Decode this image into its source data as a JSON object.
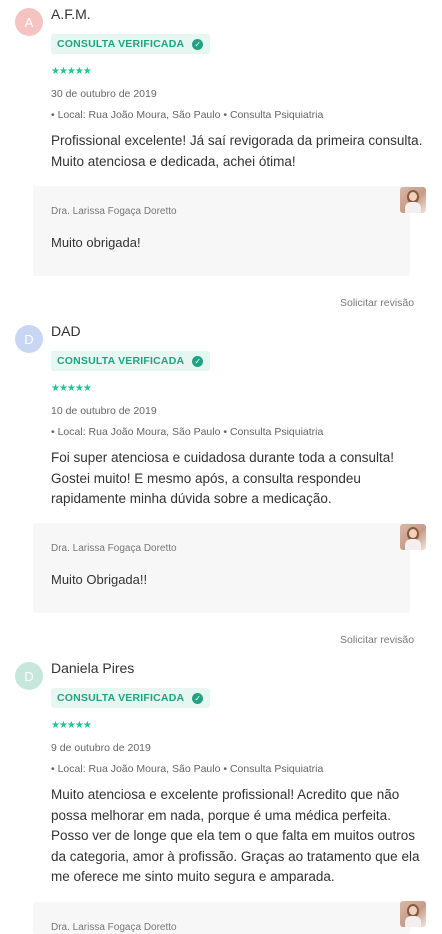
{
  "reviews": [
    {
      "initial": "A",
      "name": "A.F.M.",
      "badge": "CONSULTA VERIFICADA",
      "stars": "★★★★★",
      "date": "30 de outubro de 2019",
      "location": "• Local: Rua João Moura, São Paulo • Consulta Psiquiatria",
      "comment": "Profissional excelente! Já saí revigorada da primeira consulta. Muito atenciosa e dedicada, achei ótima!",
      "reply_author": "Dra. Larissa Fogaça Doretto",
      "reply_text": "Muito obrigada!",
      "action": "Solicitar revisão"
    },
    {
      "initial": "D",
      "name": "DAD",
      "badge": "CONSULTA VERIFICADA",
      "stars": "★★★★★",
      "date": "10 de outubro de 2019",
      "location": "• Local: Rua João Moura, São Paulo • Consulta Psiquiatria",
      "comment": "Foi super atenciosa e cuidadosa durante toda a consulta! Gostei muito! E mesmo após, a consulta respondeu rapidamente minha dúvida sobre a medicação.",
      "reply_author": "Dra. Larissa Fogaça Doretto",
      "reply_text": "Muito Obrigada!!",
      "action": "Solicitar revisão"
    },
    {
      "initial": "D",
      "name": "Daniela Pires",
      "badge": "CONSULTA VERIFICADA",
      "stars": "★★★★★",
      "date": "9 de outubro de 2019",
      "location": "• Local: Rua João Moura, São Paulo • Consulta Psiquiatria",
      "comment": "Muito atenciosa e excelente profissional! Acredito que não possa melhorar em nada, porque é uma médica perfeita. Posso ver de longe que ela tem o que falta em muitos outros da categoria, amor à profissão. Graças ao tratamento que ela me oferece me sinto muito segura e amparada.",
      "reply_author": "Dra. Larissa Fogaça Doretto"
    }
  ],
  "colors": {
    "avatar_1": "#f6c3c3",
    "avatar_2": "#c8d6f3",
    "avatar_3": "#c6e8dc",
    "verified_green": "#21a383",
    "star_green": "#21c496"
  },
  "icons": {
    "verified": "check-circle-icon",
    "rating": "star-icon"
  }
}
